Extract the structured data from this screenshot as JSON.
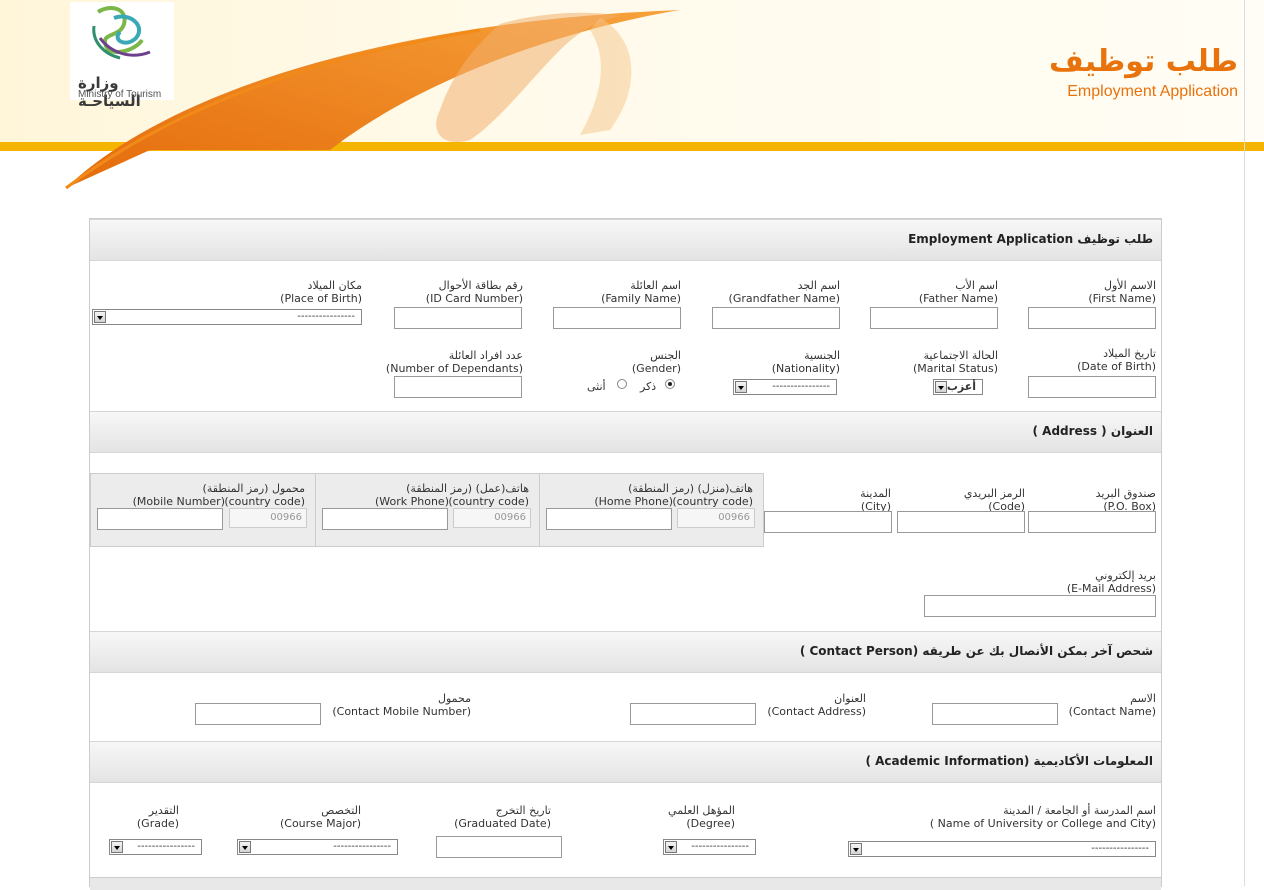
{
  "header": {
    "ministry_ar": "وزارة السياحـة",
    "ministry_en": "Ministry of Tourism",
    "title_ar": "طلب توظيف",
    "title_en": "Employment Application",
    "accent_color": "#e8720c"
  },
  "sections": {
    "personal": "طلب توظيف Employment Application",
    "address": "العنوان ( Address )",
    "contact": "شحص آخر بمكن الأنصال بك عن طريقه (Contact Person )",
    "academic": "المعلومات الأكاديمية (Academic Information )"
  },
  "personal": {
    "first_name_ar": "الاسم الأول",
    "first_name_en": "(First Name)",
    "father_name_ar": "اسم الأب",
    "father_name_en": "(Father Name)",
    "grandfather_name_ar": "اسم الجد",
    "grandfather_name_en": "(Grandfather Name)",
    "family_name_ar": "اسم العائلة",
    "family_name_en": "(Family Name)",
    "id_card_ar": "رقم بطاقة الأحوال",
    "id_card_en": "(ID Card Number)",
    "place_birth_ar": "مكان الميلاد",
    "place_birth_en": "(Place of Birth)",
    "place_birth_value": "----------------",
    "dob_ar": "تاريخ الميلاد",
    "dob_en": "(Date of Birth)",
    "marital_ar": "الحالة الاجتماعية",
    "marital_en": "(Marital Status)",
    "marital_value": "أعزب",
    "nationality_ar": "الجنسية",
    "nationality_en": "(Nationality)",
    "nationality_value": "----------------",
    "gender_ar": "الجنس",
    "gender_en": "(Gender)",
    "gender_male": "ذكر",
    "gender_female": "أنثى",
    "dependants_ar": "عدد افراد العائلة",
    "dependants_en": "(Number of Dependants)"
  },
  "address": {
    "pobox_ar": "صندوق البريد",
    "pobox_en": "(P.O. Box)",
    "code_ar": "الرمز البريدي",
    "code_en": "(Code)",
    "city_ar": "المدينة",
    "city_en": "(City)",
    "home_ar": "(رمز المنطقة)   هاتف(منزل)",
    "home_en": "(Home Phone)",
    "work_ar": "(رمز المنطقة)   هاتف(عمل)",
    "work_en": "(Work Phone)",
    "mobile_ar": "(رمز المنطقة)   محمول",
    "mobile_en": "(Mobile Number)",
    "country_code": "(country code)",
    "country_code_value": "00966",
    "email_ar": "بريد إلكتروني",
    "email_en": "(E-Mail Address)"
  },
  "contact": {
    "name_ar": "الاسم",
    "name_en": "(Contact Name)",
    "address_ar": "العنوان",
    "address_en": "(Contact Address)",
    "mobile_ar": "محمول",
    "mobile_en": "(Contact Mobile Number)"
  },
  "academic": {
    "univ_ar": "اسم المدرسة أو الجامعة / المدينة",
    "univ_en": "( Name of University or College and City)",
    "degree_ar": "المؤهل العلمي",
    "degree_en": "(Degree)",
    "grad_ar": "تاريخ التخرج",
    "grad_en": "(Graduated Date)",
    "major_ar": "التخصص",
    "major_en": "(Course Major)",
    "grade_ar": "التقدير",
    "grade_en": "(Grade)",
    "placeholder": "----------------"
  }
}
